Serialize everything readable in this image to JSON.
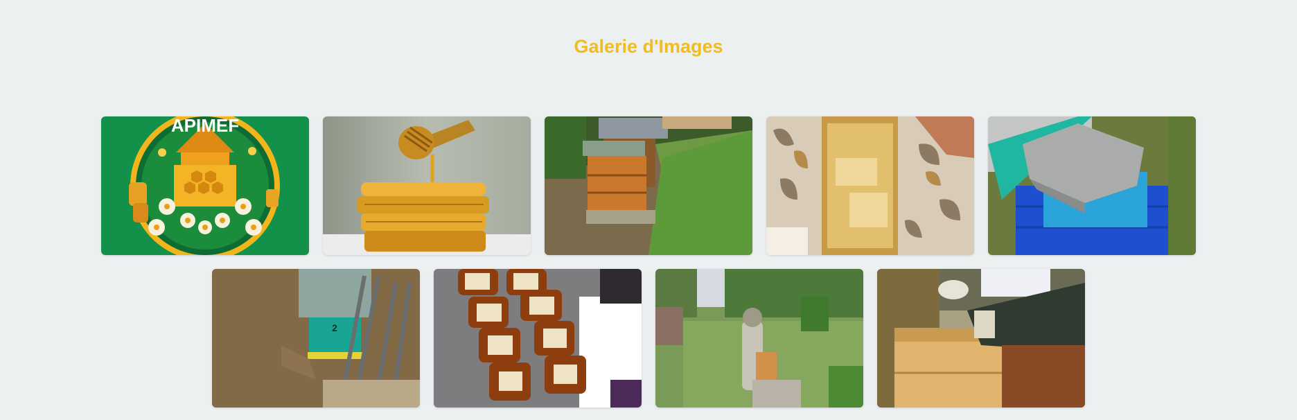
{
  "gallery": {
    "title": "Galerie d'Images",
    "logo_text": "APIMEF",
    "hive_number": "2",
    "images": [
      {
        "name": "gallery-image-apimef-logo"
      },
      {
        "name": "gallery-image-honey-dipper"
      },
      {
        "name": "gallery-image-hives-garden"
      },
      {
        "name": "gallery-image-honeycomb-frame"
      },
      {
        "name": "gallery-image-blue-hive"
      },
      {
        "name": "gallery-image-hive-number-2"
      },
      {
        "name": "gallery-image-honey-jars"
      },
      {
        "name": "gallery-image-beekeeper-garden"
      },
      {
        "name": "gallery-image-wooden-hive"
      }
    ]
  }
}
